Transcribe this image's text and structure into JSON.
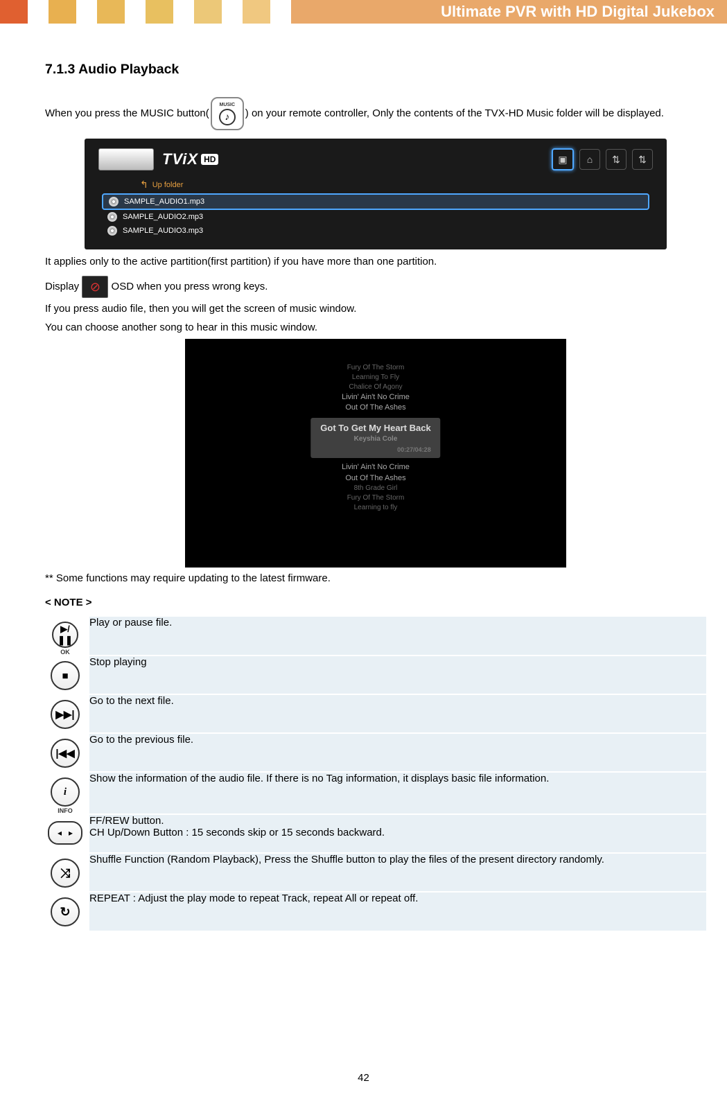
{
  "header": {
    "title": "Ultimate PVR with HD Digital Jukebox"
  },
  "section": {
    "heading": "7.1.3 Audio Playback"
  },
  "para1_a": "When you press the MUSIC button(",
  "para1_b": ") on your remote controller, Only the contents of the TVX-HD Music folder will be displayed.",
  "music_icon_label": "MUSIC",
  "tvix": {
    "logo": "TViX",
    "hd": "HD",
    "up": "Up folder",
    "files": [
      "SAMPLE_AUDIO1.mp3",
      "SAMPLE_AUDIO2.mp3",
      "SAMPLE_AUDIO3.mp3"
    ]
  },
  "para2": "It applies only to the active partition(first partition) if you have more than one partition.",
  "para3_a": "Display ",
  "para3_b": " OSD when you press wrong keys.",
  "para4": "If you press audio file, then you will get the screen of music window.",
  "para5": "You can choose another song to hear in this music window.",
  "player": {
    "above": [
      "Fury Of The Storm",
      "Learning To Fly",
      "Chalice Of Agony",
      "Livin' Ain't No Crime",
      "Out Of The Ashes"
    ],
    "current": "Got To Get My Heart Back",
    "artist": "Keyshia Cole",
    "time": "00:27/04:28",
    "below": [
      "Livin' Ain't No Crime",
      "Out Of The Ashes",
      "8th Grade Girl",
      "Fury Of The Storm",
      "Learning to fly"
    ]
  },
  "para6": "** Some functions may require updating to the latest firmware.",
  "note_heading": "< NOTE >",
  "buttons": {
    "ok_label": "OK",
    "info_label": "INFO",
    "play": "Play or pause file.",
    "stop": "Stop playing",
    "next": "Go to the next file.",
    "prev": "Go to the previous file.",
    "info": "Show the information of the audio file. If there is no Tag information, it displays basic file information.",
    "ffrew": "FF/REW button.\nCH Up/Down Button : 15 seconds skip or 15 seconds backward.",
    "shuffle": "Shuffle Function (Random Playback), Press the Shuffle button to play the files of the present directory randomly.",
    "repeat": "REPEAT : Adjust the play mode to repeat Track, repeat All or repeat off."
  },
  "page_number": "42"
}
